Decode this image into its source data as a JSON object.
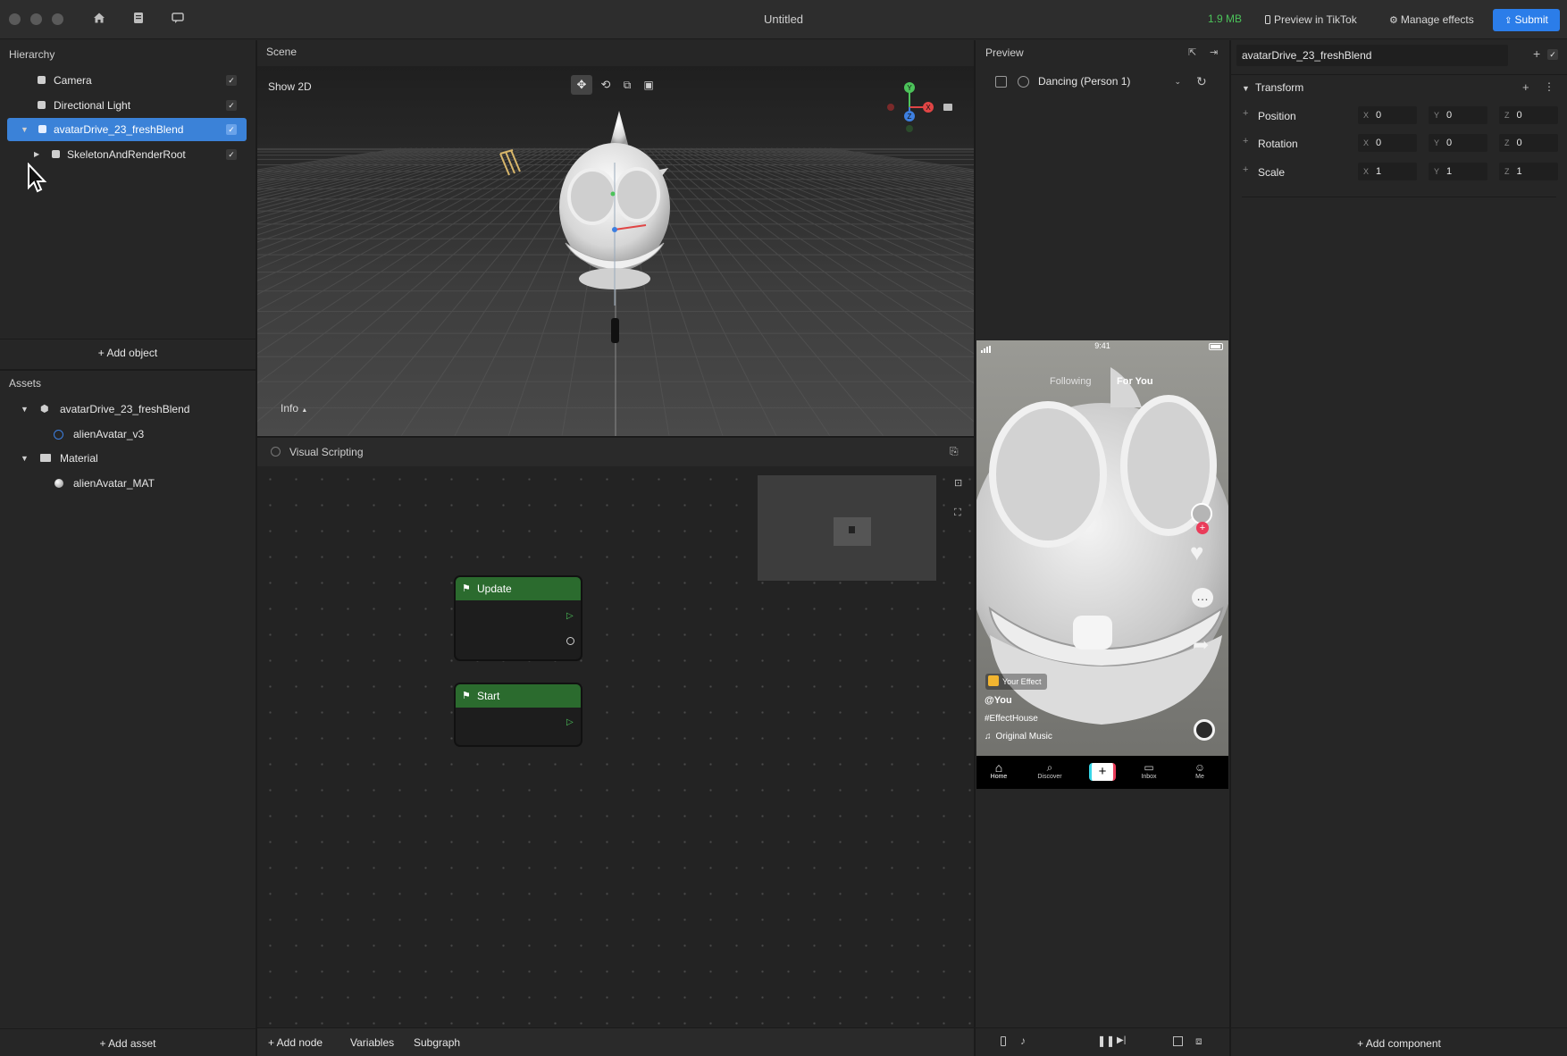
{
  "titlebar": {
    "title": "Untitled",
    "size": "1.9 MB",
    "preview_label": "Preview in TikTok",
    "manage_label": "Manage effects",
    "submit_label": "Submit",
    "icons": [
      "home-icon",
      "doc-icon",
      "chat-icon",
      "smartphone-icon",
      "gear-icon",
      "upload-icon"
    ]
  },
  "hierarchy": {
    "title": "Hierarchy",
    "items": [
      {
        "label": "Camera"
      },
      {
        "label": "Directional Light"
      },
      {
        "label": "avatarDrive_23_freshBlend"
      },
      {
        "label": "SkeletonAndRenderRoot"
      }
    ],
    "add_label": "+ Add object"
  },
  "assets": {
    "title": "Assets",
    "items": [
      {
        "label": "avatarDrive_23_freshBlend"
      },
      {
        "label": "alienAvatar_v3"
      },
      {
        "label": "Material"
      },
      {
        "label": "alienAvatar_MAT"
      }
    ],
    "add_label": "+ Add asset"
  },
  "scene": {
    "title": "Scene",
    "show2d": "Show 2D",
    "info": "Info",
    "gizmo": {
      "y": "Y",
      "x": "X",
      "z": "Z"
    }
  },
  "visual_scripting": {
    "title": "Visual Scripting",
    "nodes": [
      {
        "label": "Update"
      },
      {
        "label": "Start"
      }
    ],
    "footer": {
      "add_node": "+ Add node",
      "variables": "Variables",
      "subgraph": "Subgraph"
    }
  },
  "preview": {
    "title": "Preview",
    "dropdown": "Dancing (Person 1)",
    "phone": {
      "time": "9:41",
      "tab_following": "Following",
      "tab_foryou": "For You",
      "effect_badge": "Your Effect",
      "user": "@You",
      "hashtag": "#EffectHouse",
      "music": "Original Music",
      "nav": [
        "Home",
        "Discover",
        "Inbox",
        "Me"
      ]
    }
  },
  "inspector": {
    "object_name": "avatarDrive_23_freshBlend",
    "section": "Transform",
    "rows": [
      {
        "label": "Position",
        "x": "0",
        "y": "0",
        "z": "0"
      },
      {
        "label": "Rotation",
        "x": "0",
        "y": "0",
        "z": "0"
      },
      {
        "label": "Scale",
        "x": "1",
        "y": "1",
        "z": "1"
      }
    ],
    "add_component": "+ Add component"
  },
  "colors": {
    "accent": "#2b7de9",
    "selection": "#3b82d8",
    "node_header": "#2b6b2e",
    "size_text": "#4cc35a"
  }
}
